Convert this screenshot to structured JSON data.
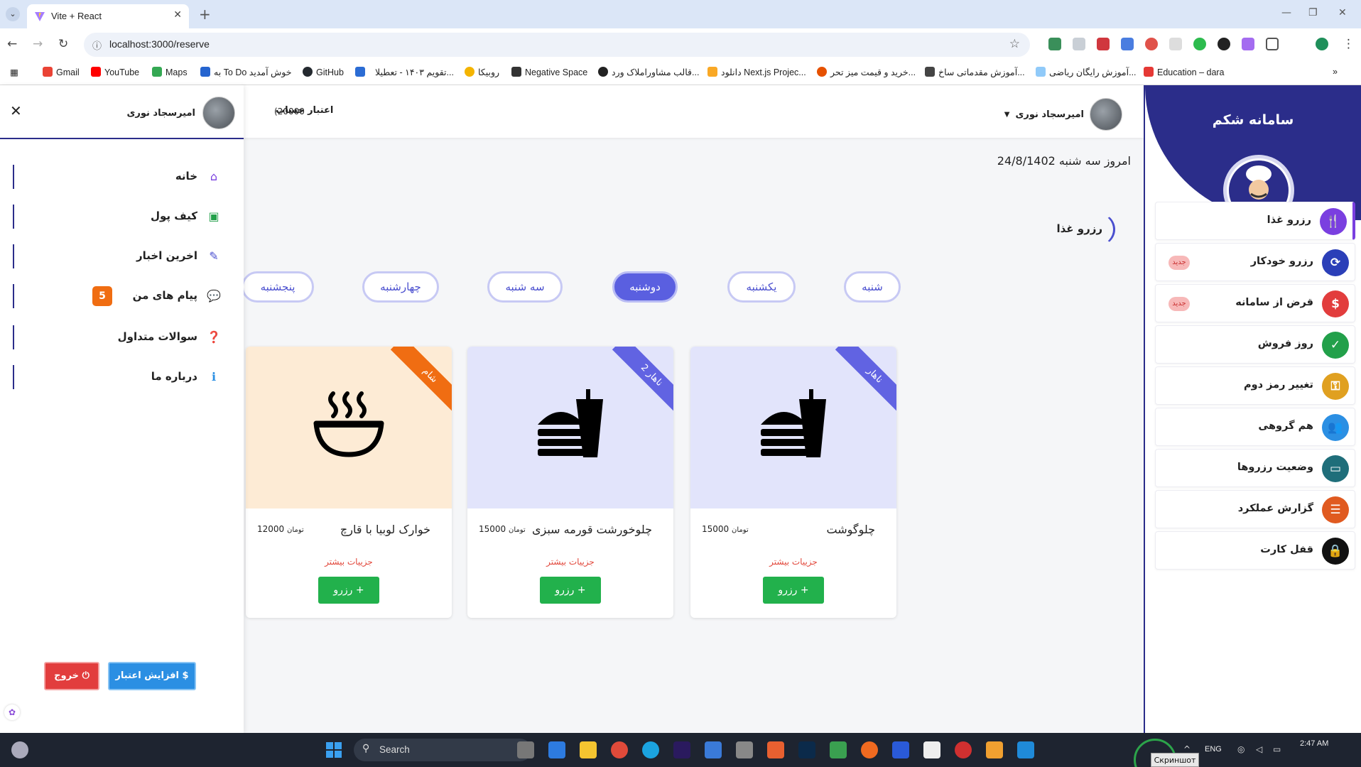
{
  "browser": {
    "tab_title": "Vite + React",
    "url": "localhost:3000/reserve",
    "bookmarks": [
      {
        "label": "Gmail",
        "color": "#ea4335"
      },
      {
        "label": "YouTube",
        "color": "#ff0000"
      },
      {
        "label": "Maps",
        "color": "#34a853"
      },
      {
        "label": "به To Do خوش آمدید",
        "color": "#2564cf"
      },
      {
        "label": "GitHub",
        "color": "#24292f"
      },
      {
        "label": "",
        "color": "#2b6cd4"
      },
      {
        "label": "تقویم ۱۴۰۳ - تعطیلا...",
        "color": "#ffffff"
      },
      {
        "label": "روبیکا",
        "color": "#f4b400"
      },
      {
        "label": "Negative Space",
        "color": "#333333"
      },
      {
        "label": "قالب مشاوراملاک ورد...",
        "color": "#222222"
      },
      {
        "label": "دانلود Next.js Projec...",
        "color": "#f9a825"
      },
      {
        "label": "خرید و قیمت میز تحر...",
        "color": "#e65100"
      },
      {
        "label": "آموزش مقدماتی ساخ...",
        "color": "#444444"
      },
      {
        "label": "آموزش رایگان ریاضی...",
        "color": "#90caf9"
      },
      {
        "label": "Education – dara",
        "color": "#e53935"
      }
    ]
  },
  "topbar": {
    "user_name": "امیرسجاد نوری"
  },
  "main": {
    "date_text": "امروز سه شنبه 24/8/1402",
    "section_title": "رزرو غذا",
    "days": [
      "شنبه",
      "یکشنبه",
      "دوشنبه",
      "سه شنبه",
      "چهارشنبه",
      "پنجشنبه"
    ],
    "active_day": "دوشنبه",
    "foods": [
      {
        "name": "چلوگوشت",
        "price": "15000",
        "unit": "تومان",
        "meal": "ناهار",
        "more": "جزییات بیشتر",
        "button": "رزرو +",
        "icon": "fastfood-icon"
      },
      {
        "name": "چلوخورشت قورمه سبزی",
        "price": "15000",
        "unit": "تومان",
        "meal": "ناهار 2",
        "more": "جزییات بیشتر",
        "button": "رزرو +",
        "icon": "fastfood-icon"
      },
      {
        "name": "خوارک لوبیا با قارچ",
        "price": "12000",
        "unit": "تومان",
        "meal": "شام",
        "more": "جزییات بیشتر",
        "button": "رزرو +",
        "icon": "soup-bowl-icon"
      }
    ]
  },
  "sidebar": {
    "title": "سامانه شکم",
    "items": [
      {
        "label": "رزرو غذا",
        "color": "#7a3fe0",
        "icon": "utensils-icon",
        "badge": ""
      },
      {
        "label": "رزرو خودکار",
        "color": "#2b3fb8",
        "icon": "auto-reserve-icon",
        "badge": "جدید"
      },
      {
        "label": "قرض از سامانه",
        "color": "#e23d3d",
        "icon": "dollar-icon",
        "badge": "جدید"
      },
      {
        "label": "روز فروش",
        "color": "#22a04a",
        "icon": "calendar-check-icon",
        "badge": ""
      },
      {
        "label": "تغییر رمز دوم",
        "color": "#e0a020",
        "icon": "key-icon",
        "badge": ""
      },
      {
        "label": "هم گروهی",
        "color": "#2b8fe3",
        "icon": "users-icon",
        "badge": ""
      },
      {
        "label": "وضعیت رزروها",
        "color": "#1f6e7a",
        "icon": "monitor-icon",
        "badge": ""
      },
      {
        "label": "گزارش عملکرد",
        "color": "#e05a20",
        "icon": "report-icon",
        "badge": ""
      },
      {
        "label": "قفل کارت",
        "color": "#111111",
        "icon": "lock-icon",
        "badge": ""
      }
    ]
  },
  "drawer": {
    "credit_label": "اعتبار حساب",
    "credit_value": "(20000",
    "user_name": "امیرسجاد نوری",
    "items": [
      {
        "label": "خانه",
        "icon": "home-icon",
        "color": "#7a3fe0"
      },
      {
        "label": "کیف پول",
        "icon": "wallet-icon",
        "color": "#22a04a"
      },
      {
        "label": "اخرین اخبار",
        "icon": "megaphone-icon",
        "color": "#4a4fcf"
      },
      {
        "label": "پیام های من",
        "icon": "chat-icon",
        "color": "#2b8fe3",
        "badge": "5"
      },
      {
        "label": "سوالات متداول",
        "icon": "help-icon",
        "color": "#e23d3d"
      },
      {
        "label": "درباره ما",
        "icon": "info-icon",
        "color": "#2b8fe3"
      }
    ],
    "credit_button": "افزایش اعتبار $",
    "exit_button": "خروج ⏻"
  },
  "taskbar": {
    "search_label": "Search",
    "lang": "ENG",
    "time": "2:47 AM",
    "screenshot_label": "Скриншот"
  }
}
